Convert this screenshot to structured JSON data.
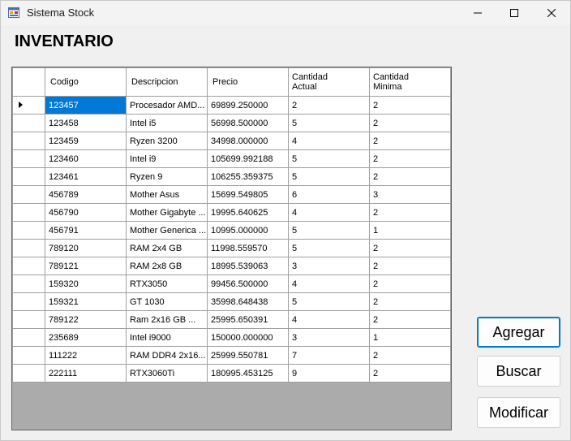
{
  "window": {
    "title": "Sistema Stock"
  },
  "heading": "INVENTARIO",
  "grid": {
    "columns": [
      "Codigo",
      "Descripcion",
      "Precio",
      "Cantidad\nActual",
      "Cantidad\nMinima"
    ],
    "rows": [
      [
        "123457",
        "Procesador AMD...",
        "69899.250000",
        "2",
        "2"
      ],
      [
        "123458",
        "Intel i5",
        "56998.500000",
        "5",
        "2"
      ],
      [
        "123459",
        "Ryzen 3200",
        "34998.000000",
        "4",
        "2"
      ],
      [
        "123460",
        "Intel i9",
        "105699.992188",
        "5",
        "2"
      ],
      [
        "123461",
        "Ryzen 9",
        "106255.359375",
        "5",
        "2"
      ],
      [
        "456789",
        "Mother Asus",
        "15699.549805",
        "6",
        "3"
      ],
      [
        "456790",
        "Mother Gigabyte ...",
        "19995.640625",
        "4",
        "2"
      ],
      [
        "456791",
        "Mother Generica ...",
        "10995.000000",
        "5",
        "1"
      ],
      [
        "789120",
        "RAM 2x4 GB",
        "11998.559570",
        "5",
        "2"
      ],
      [
        "789121",
        "RAM 2x8 GB",
        "18995.539063",
        "3",
        "2"
      ],
      [
        "159320",
        "RTX3050",
        "99456.500000",
        "4",
        "2"
      ],
      [
        "159321",
        "GT 1030",
        "35998.648438",
        "5",
        "2"
      ],
      [
        "789122",
        "Ram 2x16 GB     ...",
        "25995.650391",
        "4",
        "2"
      ],
      [
        "235689",
        "Intel i9000",
        "150000.000000",
        "3",
        "1"
      ],
      [
        "111222",
        "RAM DDR4 2x16...",
        "25999.550781",
        "7",
        "2"
      ],
      [
        "222111",
        "RTX3060Ti",
        "180995.453125",
        "9",
        "2"
      ]
    ],
    "selected_row": 0
  },
  "buttons": {
    "agregar": "Agregar",
    "buscar": "Buscar",
    "modificar": "Modificar"
  },
  "icons": {
    "app": "app-form-icon",
    "minimize": "minimize-icon",
    "maximize": "maximize-icon",
    "close": "close-icon",
    "row_pointer": "row-pointer-icon"
  },
  "colors": {
    "selection": "#0078d7",
    "grid_empty_area": "#ababab"
  }
}
